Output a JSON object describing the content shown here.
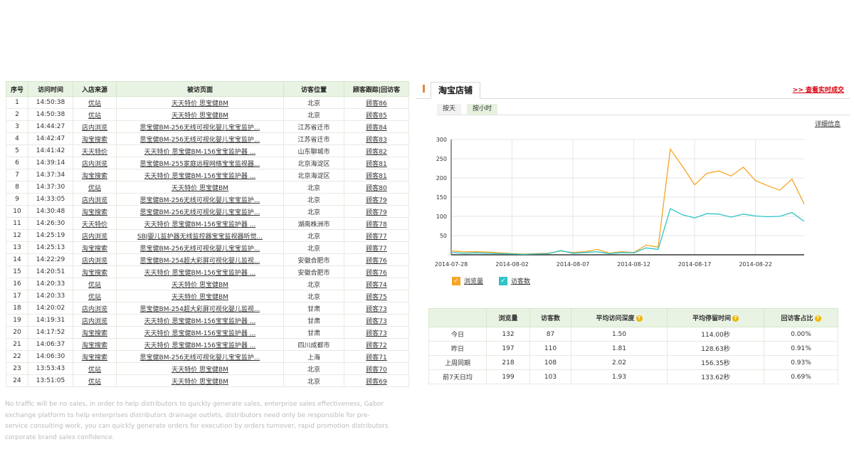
{
  "visitor_table": {
    "columns": [
      "序号",
      "访问时间",
      "入店来源",
      "被访页面",
      "访客位置",
      "顾客跟踪|回访客"
    ],
    "rows": [
      {
        "no": "1",
        "time": "14:50:38",
        "source": "优站",
        "page": "天天特价 思宝健BM",
        "location": "北京",
        "tracking": "顾客86"
      },
      {
        "no": "2",
        "time": "14:50:38",
        "source": "优站",
        "page": "天天特价 思宝健BM",
        "location": "北京",
        "tracking": "顾客85"
      },
      {
        "no": "3",
        "time": "14:44:27",
        "source": "店内浏览",
        "page": "思宝健BM-256无线可视化婴儿宝宝监护...",
        "location": "江苏省迁市",
        "tracking": "顾客84"
      },
      {
        "no": "4",
        "time": "14:42:47",
        "source": "淘宝搜索",
        "page": "思宝健BM-256无线可视化婴儿宝宝监护...",
        "location": "江苏省迁市",
        "tracking": "顾客83"
      },
      {
        "no": "5",
        "time": "14:41:42",
        "source": "天天特价",
        "page": "天天特价 思宝健BM-156宝宝监护器 ...",
        "location": "山东聊城市",
        "tracking": "顾客82"
      },
      {
        "no": "6",
        "time": "14:39:14",
        "source": "店内浏览",
        "page": "思宝健BM-255家庭远程网络宝宝监视器...",
        "location": "北京海淀区",
        "tracking": "顾客81"
      },
      {
        "no": "7",
        "time": "14:37:34",
        "source": "淘宝搜索",
        "page": "天天特价 思宝健BM-156宝宝监护器 ...",
        "location": "北京海淀区",
        "tracking": "顾客81"
      },
      {
        "no": "8",
        "time": "14:37:30",
        "source": "优站",
        "page": "天天特价 思宝健BM",
        "location": "北京",
        "tracking": "顾客80"
      },
      {
        "no": "9",
        "time": "14:33:05",
        "source": "店内浏览",
        "page": "思宝健BM-256无线可视化婴儿宝宝监护...",
        "location": "北京",
        "tracking": "顾客79"
      },
      {
        "no": "10",
        "time": "14:30:48",
        "source": "淘宝搜索",
        "page": "思宝健BM-256无线可视化婴儿宝宝监护...",
        "location": "北京",
        "tracking": "顾客79"
      },
      {
        "no": "11",
        "time": "14:26:30",
        "source": "天天特价",
        "page": "天天特价 思宝健BM-156宝宝监护器 ...",
        "location": "湖南株洲市",
        "tracking": "顾客78"
      },
      {
        "no": "12",
        "time": "14:25:19",
        "source": "店内浏览",
        "page": "SBJ婴儿监护器无线监控器宝宝监视器听觉...",
        "location": "北京",
        "tracking": "顾客77"
      },
      {
        "no": "13",
        "time": "14:25:13",
        "source": "淘宝搜索",
        "page": "思宝健BM-256无线可视化婴儿宝宝监护...",
        "location": "北京",
        "tracking": "顾客77"
      },
      {
        "no": "14",
        "time": "14:22:29",
        "source": "店内浏览",
        "page": "思宝健BM-254超大彩屏可视化婴儿监视...",
        "location": "安徽合肥市",
        "tracking": "顾客76"
      },
      {
        "no": "15",
        "time": "14:20:51",
        "source": "淘宝搜索",
        "page": "天天特价 思宝健BM-156宝宝监护器 ...",
        "location": "安徽合肥市",
        "tracking": "顾客76"
      },
      {
        "no": "16",
        "time": "14:20:33",
        "source": "优站",
        "page": "天天特价 思宝健BM",
        "location": "北京",
        "tracking": "顾客74"
      },
      {
        "no": "17",
        "time": "14:20:33",
        "source": "优站",
        "page": "天天特价 思宝健BM",
        "location": "北京",
        "tracking": "顾客75"
      },
      {
        "no": "18",
        "time": "14:20:02",
        "source": "店内浏览",
        "page": "思宝健BM-254超大彩屏可视化婴儿监视...",
        "location": "甘肃",
        "tracking": "顾客73"
      },
      {
        "no": "19",
        "time": "14:19:31",
        "source": "店内浏览",
        "page": "天天特价 思宝健BM-156宝宝监护器 ...",
        "location": "甘肃",
        "tracking": "顾客73"
      },
      {
        "no": "20",
        "time": "14:17:52",
        "source": "淘宝搜索",
        "page": "天天特价 思宝健BM-156宝宝监护器 ...",
        "location": "甘肃",
        "tracking": "顾客73"
      },
      {
        "no": "21",
        "time": "14:06:37",
        "source": "淘宝搜索",
        "page": "天天特价 思宝健BM-156宝宝监护器 ...",
        "location": "四川成都市",
        "tracking": "顾客72"
      },
      {
        "no": "22",
        "time": "14:06:30",
        "source": "淘宝搜索",
        "page": "思宝健BM-256无线可视化婴儿宝宝监护...",
        "location": "上海",
        "tracking": "顾客71"
      },
      {
        "no": "23",
        "time": "13:53:43",
        "source": "优站",
        "page": "天天特价 思宝健BM",
        "location": "北京",
        "tracking": "顾客70"
      },
      {
        "no": "24",
        "time": "13:51:05",
        "source": "优站",
        "page": "天天特价 思宝健BM",
        "location": "北京",
        "tracking": "顾客69"
      }
    ]
  },
  "footer_text": "No traffic will be no sales, in order to help distributors to quickly generate sales, enterprise sales effectiveness, Gabor exchange platform to help enterprises distributors drainage outlets, distributors need only be responsible for pre-service consulting work, you can quickly generate orders for execution by orders turnover, rapid promotion distributors corporate brand sales confidence.",
  "shop": {
    "title": "淘宝店铺",
    "realtime_link": ">> 查看实时成交",
    "tabs": [
      "按天",
      "按小时"
    ],
    "details_link": "详细信息"
  },
  "chart_data": {
    "type": "line",
    "x": [
      "2014-07-28",
      "2014-07-29",
      "2014-07-30",
      "2014-07-31",
      "2014-08-01",
      "2014-08-02",
      "2014-08-03",
      "2014-08-04",
      "2014-08-05",
      "2014-08-06",
      "2014-08-07",
      "2014-08-08",
      "2014-08-09",
      "2014-08-10",
      "2014-08-11",
      "2014-08-12",
      "2014-08-13",
      "2014-08-14",
      "2014-08-15",
      "2014-08-16",
      "2014-08-17",
      "2014-08-18",
      "2014-08-19",
      "2014-08-20",
      "2014-08-21",
      "2014-08-22",
      "2014-08-23",
      "2014-08-24",
      "2014-08-25",
      "2014-08-26"
    ],
    "x_tick_labels": [
      "2014-07-28",
      "2014-08-02",
      "2014-08-07",
      "2014-08-12",
      "2014-08-17",
      "2014-08-22"
    ],
    "ylim": [
      0,
      300
    ],
    "y_ticks": [
      50,
      100,
      150,
      200,
      250,
      300
    ],
    "grid": true,
    "legend_position": "bottom-left",
    "series": [
      {
        "name": "浏览量",
        "color": "#f5a623",
        "values": [
          10,
          8,
          8,
          7,
          5,
          3,
          2,
          3,
          4,
          10,
          6,
          8,
          14,
          4,
          8,
          6,
          25,
          20,
          275,
          230,
          182,
          212,
          218,
          205,
          228,
          193,
          180,
          168,
          197,
          132
        ]
      },
      {
        "name": "访客数",
        "color": "#2ec4c6",
        "values": [
          6,
          4,
          5,
          4,
          3,
          2,
          1,
          2,
          3,
          11,
          4,
          6,
          8,
          3,
          6,
          5,
          18,
          14,
          120,
          104,
          96,
          107,
          106,
          98,
          106,
          101,
          99,
          100,
          110,
          87
        ]
      }
    ]
  },
  "summary_table": {
    "columns": [
      "",
      "浏览量",
      "访客数",
      "平均访问深度",
      "平均停留时间",
      "回访客占比"
    ],
    "rows": [
      [
        "今日",
        "132",
        "87",
        "1.50",
        "114.00秒",
        "0.00%"
      ],
      [
        "昨日",
        "197",
        "110",
        "1.81",
        "128.63秒",
        "0.91%"
      ],
      [
        "上周同期",
        "218",
        "108",
        "2.02",
        "156.35秒",
        "0.93%"
      ],
      [
        "前7天日均",
        "199",
        "103",
        "1.93",
        "133.62秒",
        "0.69%"
      ]
    ]
  },
  "colors": {
    "header_bg": "#e9f3e3",
    "accent_red": "#d8000f",
    "accent_orange": "#e3853a"
  }
}
